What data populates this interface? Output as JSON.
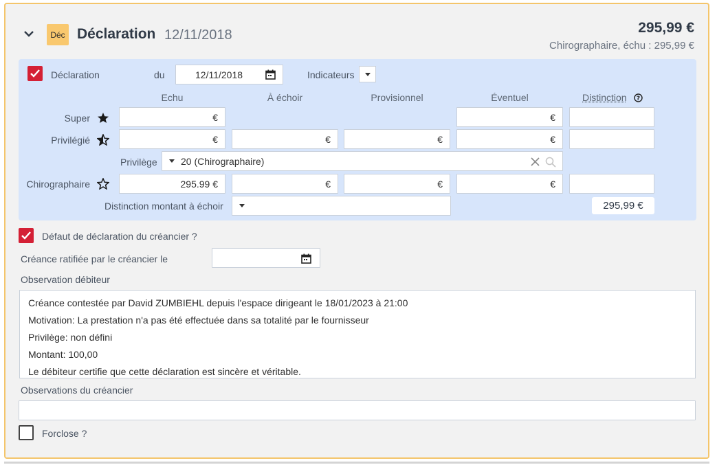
{
  "header": {
    "badge": "Déc",
    "title": "Déclaration",
    "date": "12/11/2018",
    "amount": "295,99 €",
    "subtitle": "Chirographaire, échu : 295,99 €"
  },
  "declaration": {
    "checkbox_label": "Déclaration",
    "du_label": "du",
    "date_value": "12/11/2018",
    "indicateurs_label": "Indicateurs"
  },
  "columns": [
    "Echu",
    "À échoir",
    "Provisionnel",
    "Éventuel",
    "Distinction"
  ],
  "rows": [
    {
      "label": "Super",
      "icon": "star-filled-icon",
      "values": [
        "€",
        "",
        "",
        "€",
        ""
      ]
    },
    {
      "label": "Privilégié",
      "icon": "star-half-icon",
      "values": [
        "€",
        "€",
        "€",
        "€",
        ""
      ]
    },
    {
      "label": "Chirographaire",
      "icon": "star-outline-icon",
      "values": [
        "295.99 €",
        "€",
        "€",
        "€",
        ""
      ]
    }
  ],
  "privilege": {
    "label": "Privilège",
    "value": "20 (Chirographaire)"
  },
  "distinction_montant": {
    "label": "Distinction montant à échoir",
    "total": "295,99 €"
  },
  "defaut": {
    "label": "Défaut de déclaration du créancier ?",
    "checked": true
  },
  "creance_ratifiee": {
    "label": "Créance ratifiée par le créancier le",
    "value": ""
  },
  "observation_debiteur": {
    "label": "Observation débiteur",
    "lines": [
      "Créance contestée par David ZUMBIEHL depuis l'espace dirigeant le 18/01/2023 à 21:00",
      "Motivation: La prestation n'a pas été effectuée dans sa totalité par le fournisseur",
      "Privilège: non défini",
      "Montant: 100,00",
      "Le débiteur certifie que cette déclaration est sincère et véritable."
    ]
  },
  "observations_creancier": {
    "label": "Observations du créancier",
    "value": ""
  },
  "forclose": {
    "label": "Forclose ?",
    "checked": false
  },
  "colors": {
    "accent": "#d42035",
    "panel": "#d7e5fb",
    "border": "#f4c56b",
    "badge": "#f9c86e"
  }
}
